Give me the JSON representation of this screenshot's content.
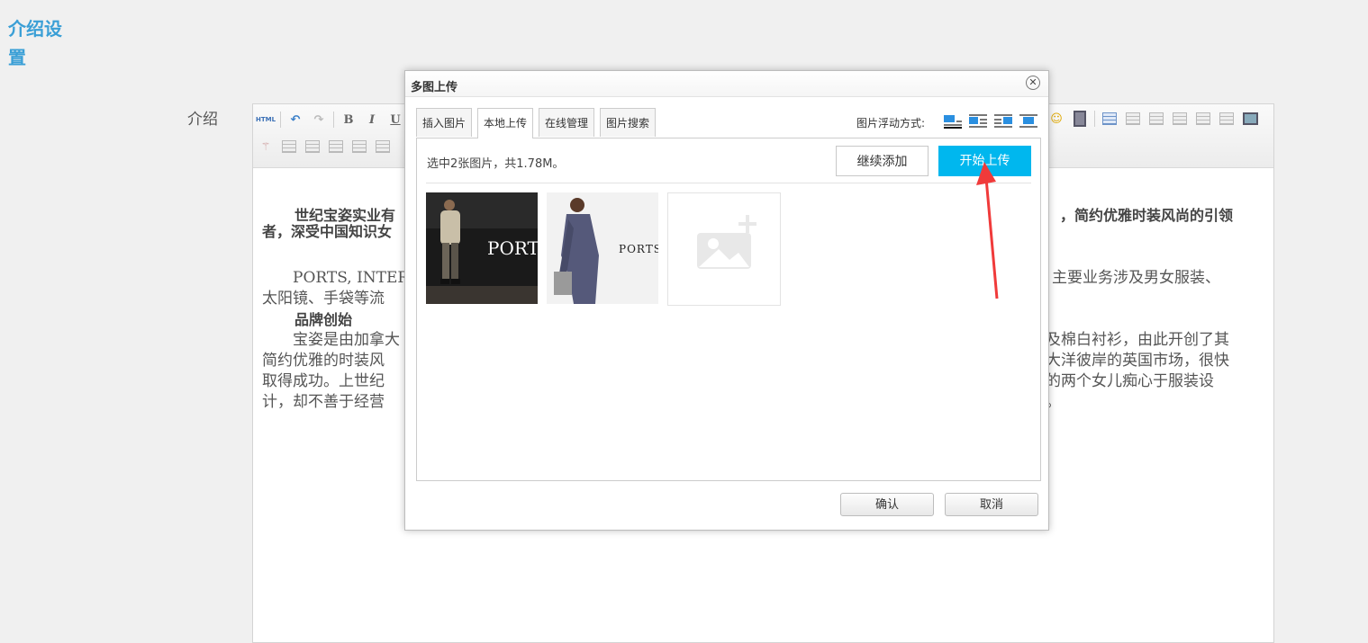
{
  "page": {
    "section_title": "介绍设置",
    "field_label": "介绍"
  },
  "editor": {
    "toolbar": {
      "html_label": "HTML",
      "bold_label": "B",
      "italic_label": "I",
      "underline_label": "U"
    },
    "content": {
      "para1_left": "世纪宝姿实业有",
      "para1_right": "，简约优雅时装风尚的引领",
      "para1_line2": "者，深受中国知识女",
      "para2_left": "PORTS, INTERNA",
      "para2_right": "，主要业务涉及男女服装、",
      "para2_line2": "太阳镜、手袋等流",
      "heading": "品牌创始",
      "para3_l1_left": "宝姿是由加拿大",
      "para3_l1_right": "及棉白衬衫，由此开创了其",
      "para3_l2_left": "简约优雅的时装风",
      "para3_l2_right": "大洋彼岸的英国市场，很快",
      "para3_l3_left": "取得成功。上世纪",
      "para3_l3_right": "的两个女儿痴心于服装设",
      "para3_l4_left": "计，却不善于经营",
      "para3_l4_right": "。"
    }
  },
  "dialog": {
    "title": "多图上传",
    "close_icon": "close-icon",
    "tabs": [
      {
        "label": "插入图片",
        "active": false
      },
      {
        "label": "本地上传",
        "active": true
      },
      {
        "label": "在线管理",
        "active": false
      },
      {
        "label": "图片搜索",
        "active": false
      }
    ],
    "float_label": "图片浮动方式:",
    "float_options": [
      "none",
      "left",
      "right",
      "center"
    ],
    "status_text": "选中2张图片，共1.78M。",
    "add_more_label": "继续添加",
    "upload_label": "开始上传",
    "upload_color": "#00b7ee",
    "thumbnails": [
      {
        "brand": "PORTS"
      },
      {
        "brand": "PORTS"
      }
    ],
    "confirm_label": "确认",
    "cancel_label": "取消"
  },
  "annotation": {
    "type": "red-arrow",
    "color": "#f03a3a"
  }
}
